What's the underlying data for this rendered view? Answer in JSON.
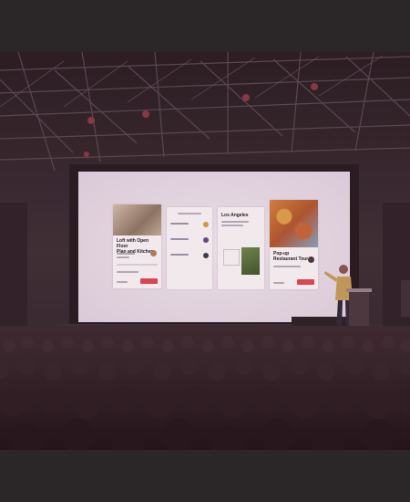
{
  "slide": {
    "card1_title": "Loft with Open Floor\nPlan and Kitchen",
    "card3_title": "Los Angeles",
    "card4_title": "Pop-up\nRestaurant Tour"
  },
  "colors": {
    "stage_wall": "#3a2f34",
    "screen": "#efeaf2",
    "accent": "#e84a52",
    "audience": "#1f1719"
  }
}
